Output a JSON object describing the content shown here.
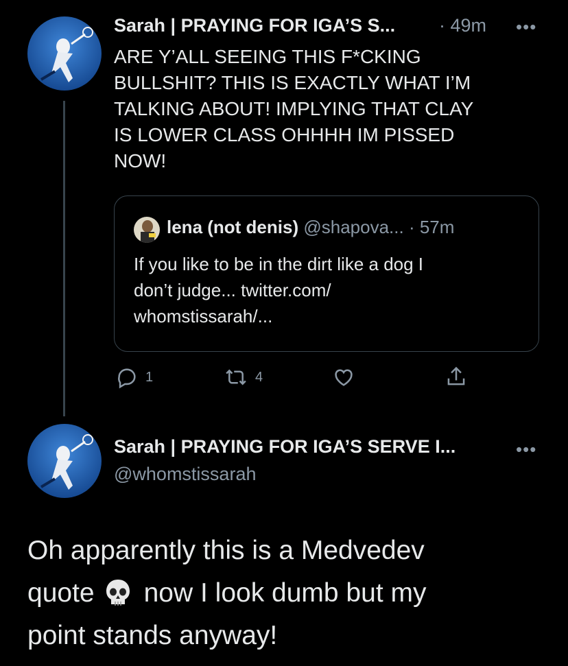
{
  "tweet1": {
    "display_name": "Sarah | PRAYING FOR IGA’S S...",
    "time": "· 49m",
    "body": "ARE Y’ALL SEEING THIS F*CKING\nBULLSHIT? THIS IS EXACTLY WHAT I’M\nTALKING ABOUT! IMPLYING THAT CLAY\nIS LOWER CLASS OHHHH IM PISSED\nNOW!",
    "quoted": {
      "display_name": "lena (not denis)",
      "handle": "@shapova...",
      "time": "· 57m",
      "text": "If you like to be in the dirt like a dog I\ndon’t judge... twitter.com/\nwhomstissarah/..."
    },
    "actions": {
      "reply_count": "1",
      "retweet_count": "4"
    },
    "icons": [
      "more-icon",
      "reply-icon",
      "retweet-icon",
      "like-icon",
      "share-icon"
    ]
  },
  "tweet2": {
    "display_name": "Sarah | PRAYING FOR IGA’S SERVE I...",
    "handle": "@whomstissarah",
    "body_part1": "Oh apparently this is a Medvedev",
    "body_part2_pre": "quote",
    "body_part2_post": "now I look dumb but my",
    "body_part3": "point stands anyway!"
  },
  "colors": {
    "background": "#000000",
    "text": "#e7e9ea",
    "muted": "#8b98a5",
    "border": "#38444d",
    "avatar_court": "#1e5fb0"
  }
}
